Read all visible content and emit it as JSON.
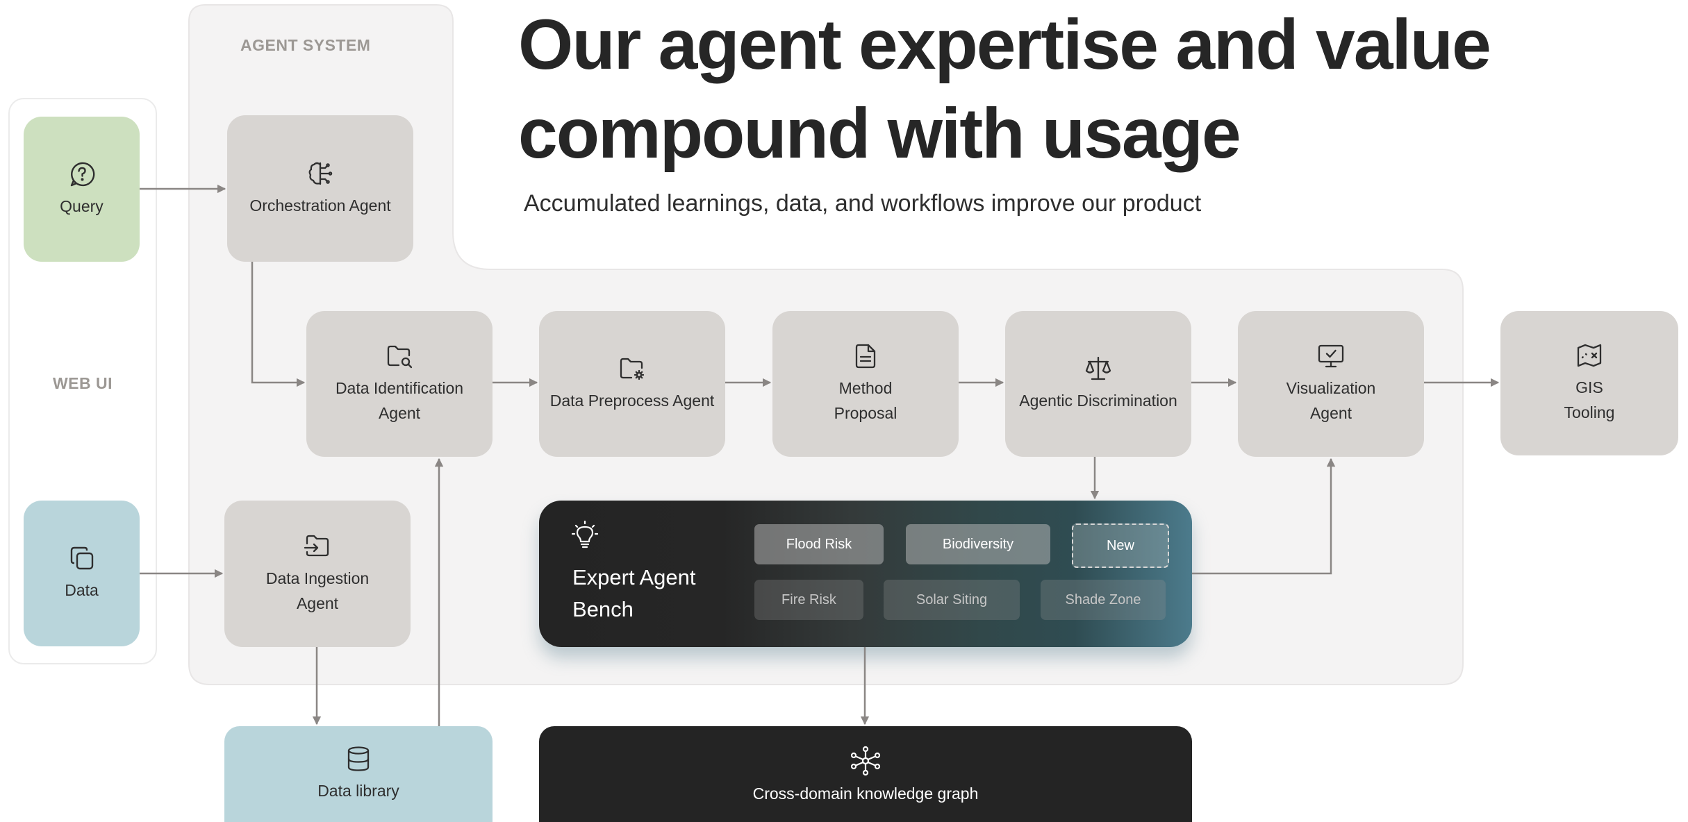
{
  "title": "Our agent expertise and value\ncompound with usage",
  "subtitle": "Accumulated learnings, data, and workflows improve our product",
  "sections": {
    "web_ui": "WEB UI",
    "agent_system": "AGENT SYSTEM"
  },
  "web_ui": {
    "query": {
      "label": "Query",
      "icon": "question-circle-icon"
    },
    "data": {
      "label": "Data",
      "icon": "copy-files-icon"
    }
  },
  "agents": {
    "orchestration": {
      "label": "Orchestration Agent",
      "icon": "brain-circuit-icon"
    },
    "data_identification": {
      "label": "Data Identification\nAgent",
      "icon": "folder-search-icon"
    },
    "data_preprocess": {
      "label": "Data Preprocess Agent",
      "icon": "folder-gear-icon"
    },
    "method_proposal": {
      "label": "Method\nProposal",
      "icon": "document-icon"
    },
    "agentic_discrimination": {
      "label": "Agentic Discrimination",
      "icon": "scale-icon"
    },
    "visualization": {
      "label": "Visualization\nAgent",
      "icon": "monitor-check-icon"
    },
    "gis_tooling": {
      "label": "GIS\nTooling",
      "icon": "map-x-icon"
    },
    "data_ingestion": {
      "label": "Data Ingestion\nAgent",
      "icon": "folder-input-icon"
    }
  },
  "data_library": {
    "label": "Data library",
    "icon": "database-icon"
  },
  "expert_bench": {
    "title": "Expert Agent\nBench",
    "icon": "lightbulb-icon",
    "chips_row1": [
      "Flood Risk",
      "Biodiversity",
      "New"
    ],
    "chips_row2": [
      "Fire Risk",
      "Solar Siting",
      "Shade Zone"
    ]
  },
  "knowledge_graph": {
    "label": "Cross-domain knowledge graph",
    "icon": "network-icon"
  },
  "colors": {
    "box_grey": "#d8d5d2",
    "query_green": "#cde0bf",
    "data_blue": "#b9d5db",
    "panel": "#f4f3f3",
    "arrow": "#8a8684",
    "dark": "#242424"
  }
}
